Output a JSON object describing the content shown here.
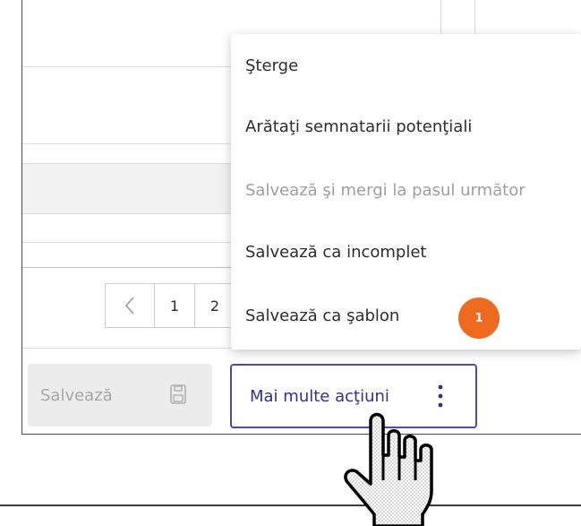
{
  "menu": {
    "items": [
      {
        "label": "Şterge",
        "disabled": false
      },
      {
        "label": "Arătaţi semnatarii potenţiali",
        "disabled": false
      },
      {
        "label": "Salvează şi mergi la pasul următor",
        "disabled": true
      },
      {
        "label": "Salvează ca incomplet",
        "disabled": false
      },
      {
        "label": "Salvează ca şablon",
        "disabled": false
      }
    ]
  },
  "badge": {
    "text": "1",
    "color": "#ee6a1f"
  },
  "pagination": {
    "prev_icon": "chevron-left-icon",
    "pages": [
      "1",
      "2"
    ]
  },
  "footer": {
    "save_label": "Salvează",
    "save_icon": "floppy-disk-icon",
    "more_label": "Mai multe acţiuni",
    "more_icon": "vertical-dots-icon"
  },
  "colors": {
    "accent": "#2e3192",
    "badge": "#ee6a1f",
    "disabled": "#9e9e9e"
  }
}
